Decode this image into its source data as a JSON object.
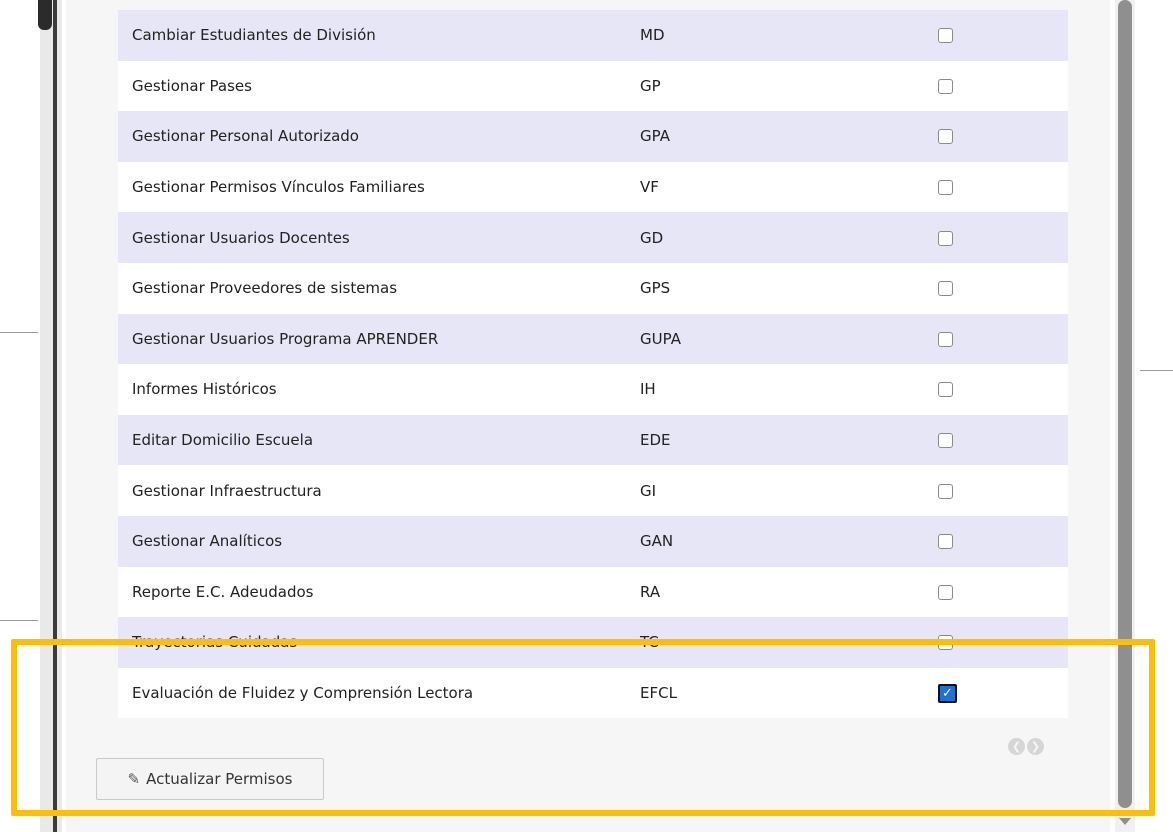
{
  "permissions": [
    {
      "name": "Cambiar Estudiantes de División",
      "code": "MD",
      "checked": false
    },
    {
      "name": "Gestionar Pases",
      "code": "GP",
      "checked": false
    },
    {
      "name": "Gestionar Personal Autorizado",
      "code": "GPA",
      "checked": false
    },
    {
      "name": "Gestionar Permisos Vínculos Familiares",
      "code": "VF",
      "checked": false
    },
    {
      "name": "Gestionar Usuarios Docentes",
      "code": "GD",
      "checked": false
    },
    {
      "name": "Gestionar Proveedores de sistemas",
      "code": "GPS",
      "checked": false
    },
    {
      "name": "Gestionar Usuarios Programa APRENDER",
      "code": "GUPA",
      "checked": false
    },
    {
      "name": "Informes Históricos",
      "code": "IH",
      "checked": false
    },
    {
      "name": "Editar Domicilio Escuela",
      "code": "EDE",
      "checked": false
    },
    {
      "name": "Gestionar Infraestructura",
      "code": "GI",
      "checked": false
    },
    {
      "name": "Gestionar Analíticos",
      "code": "GAN",
      "checked": false
    },
    {
      "name": "Reporte E.C. Adeudados",
      "code": "RA",
      "checked": false
    },
    {
      "name": "Trayectorias Cuidadas",
      "code": "TC",
      "checked": false
    },
    {
      "name": "Evaluación de Fluidez y Comprensión Lectora",
      "code": "EFCL",
      "checked": true
    }
  ],
  "update_button": {
    "label": "Actualizar Permisos",
    "icon": "edit-icon"
  },
  "pager": {
    "prev_icon": "circle-arrow-left-icon",
    "next_icon": "circle-arrow-right-icon"
  },
  "colors": {
    "row_stripe": "#e6e6f6",
    "highlight": "#ffbe00",
    "checked": "#1f6fd6"
  }
}
